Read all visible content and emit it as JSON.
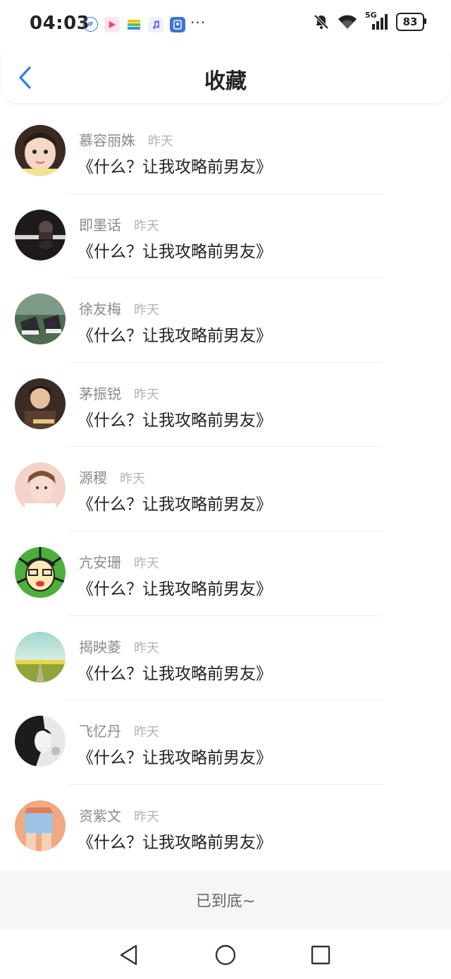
{
  "status_bar": {
    "time": "04:03",
    "battery": "83",
    "network": "5G",
    "app_icons": [
      "ifly-icon",
      "video-app-icon",
      "wallet-app-icon",
      "music-app-icon",
      "id-app-icon"
    ]
  },
  "header": {
    "title": "收藏",
    "back_icon": "chevron-left-icon",
    "accent_color": "#2f7fe0"
  },
  "favorites": [
    {
      "author": "慕容丽姝",
      "time": "昨天",
      "book": "《什么？让我攻略前男友》"
    },
    {
      "author": "即墨话",
      "time": "昨天",
      "book": "《什么？让我攻略前男友》"
    },
    {
      "author": "徐友梅",
      "time": "昨天",
      "book": "《什么？让我攻略前男友》"
    },
    {
      "author": "茅振锐",
      "time": "昨天",
      "book": "《什么？让我攻略前男友》"
    },
    {
      "author": "源稷",
      "time": "昨天",
      "book": "《什么？让我攻略前男友》"
    },
    {
      "author": "亢安珊",
      "time": "昨天",
      "book": "《什么？让我攻略前男友》"
    },
    {
      "author": "揭映菱",
      "time": "昨天",
      "book": "《什么？让我攻略前男友》"
    },
    {
      "author": "飞忆丹",
      "time": "昨天",
      "book": "《什么？让我攻略前男友》"
    },
    {
      "author": "资紫文",
      "time": "昨天",
      "book": "《什么？让我攻略前男友》"
    }
  ],
  "footer": {
    "end_text": "已到底~"
  },
  "nav_bar": {
    "icons": [
      "back-triangle-icon",
      "home-circle-icon",
      "recents-square-icon"
    ]
  }
}
